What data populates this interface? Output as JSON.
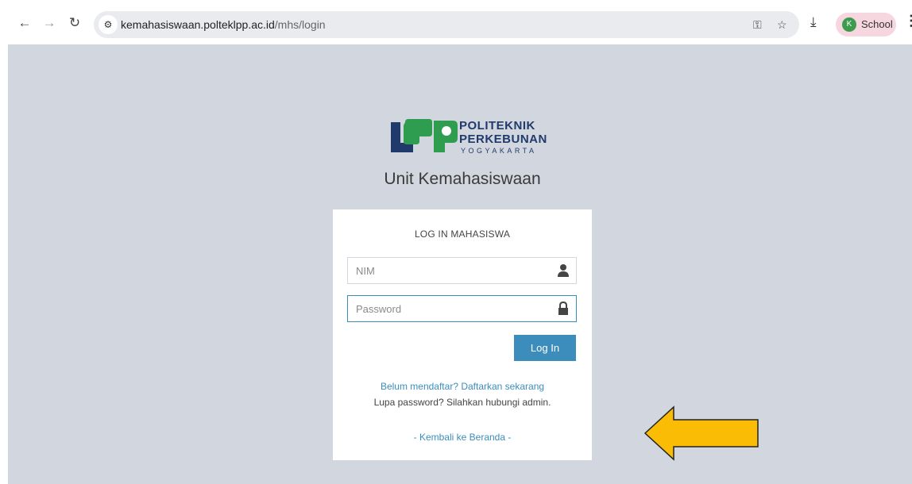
{
  "browser": {
    "url_host": "kemahasiswaan.polteklpp.ac.id",
    "url_path": "/mhs/login",
    "profile_initial": "K",
    "profile_label": "School",
    "icons": [
      "back-arrow-icon",
      "forward-arrow-icon",
      "reload-icon",
      "site-info-icon",
      "password-key-icon",
      "bookmark-star-icon",
      "download-icon",
      "more-menu-icon"
    ]
  },
  "logo": {
    "line1": "POLITEKNIK",
    "line2": "PERKEBUNAN",
    "line3": "YOGYAKARTA",
    "colors": {
      "navy": "#1f3a6b",
      "green": "#2e9d4f"
    }
  },
  "page": {
    "heading": "Unit Kemahasiswaan"
  },
  "login": {
    "title": "LOG IN MAHASISWA",
    "nim_placeholder": "NIM",
    "password_placeholder": "Password",
    "submit_label": "Log In",
    "register_link": "Belum mendaftar? Daftarkan sekarang",
    "forgot_text": "Lupa password? Silahkan hubungi admin.",
    "back_link": "- Kembali ke Beranda -"
  },
  "colors": {
    "page_background": "#d2d6de",
    "primary": "#3c8dbc",
    "annotation_arrow": "#fbbc05"
  }
}
